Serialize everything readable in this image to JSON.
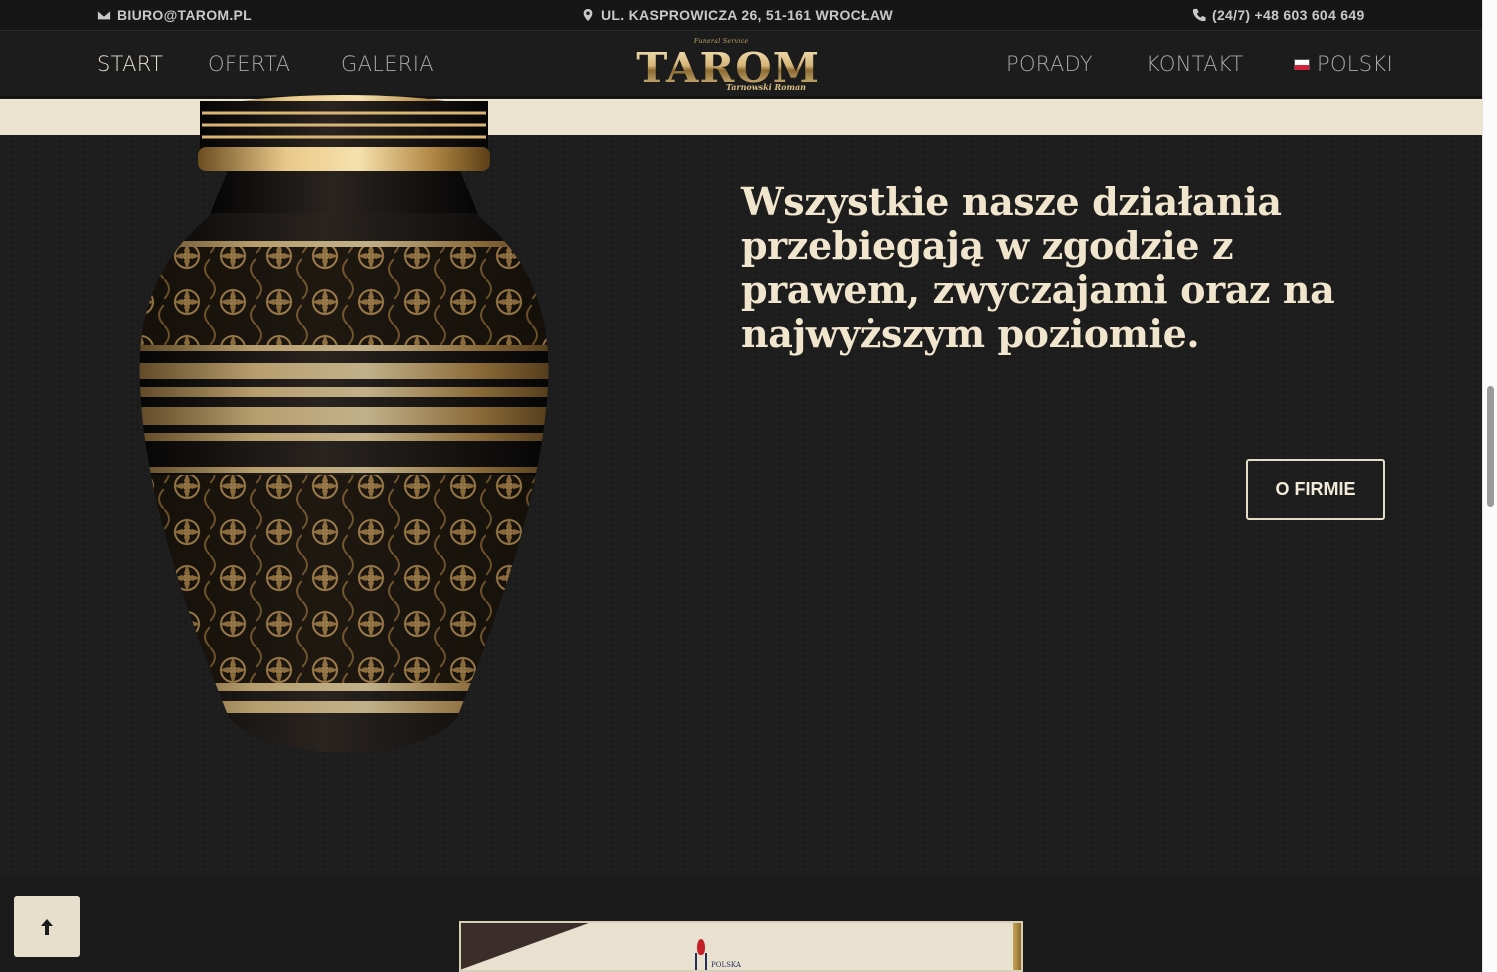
{
  "topbar": {
    "email": "BIURO@TAROM.PL",
    "address": "UL. KASPROWICZA 26, 51-161 WROCŁAW",
    "phone": "(24/7) +48 603 604 649"
  },
  "nav": {
    "left": [
      {
        "label": "START",
        "active": true
      },
      {
        "label": "OFERTA",
        "active": false
      },
      {
        "label": "GALERIA",
        "active": false
      }
    ],
    "right": [
      {
        "label": "PORADY"
      },
      {
        "label": "KONTAKT"
      }
    ],
    "language": "POLSKI"
  },
  "logo": {
    "top": "Funeral Service",
    "name": "TAROM",
    "bottom": "Tarnowski Roman"
  },
  "hero": {
    "headline": "Wszystkie nasze działania przebiegają w zgodzie z prawem, zwyczajami oraz na najwyższym poziomie.",
    "button": "O FIRMIE"
  },
  "certificate": {
    "text": "POLSKA"
  },
  "colors": {
    "background": "#1d1d1e",
    "cream": "#ece4cf",
    "headline": "#f1e6cd",
    "gold": "#c9a35c"
  },
  "icons": {
    "email": "envelope-icon",
    "address": "map-pin-icon",
    "phone": "phone-icon",
    "scroll": "arrow-up-icon"
  }
}
